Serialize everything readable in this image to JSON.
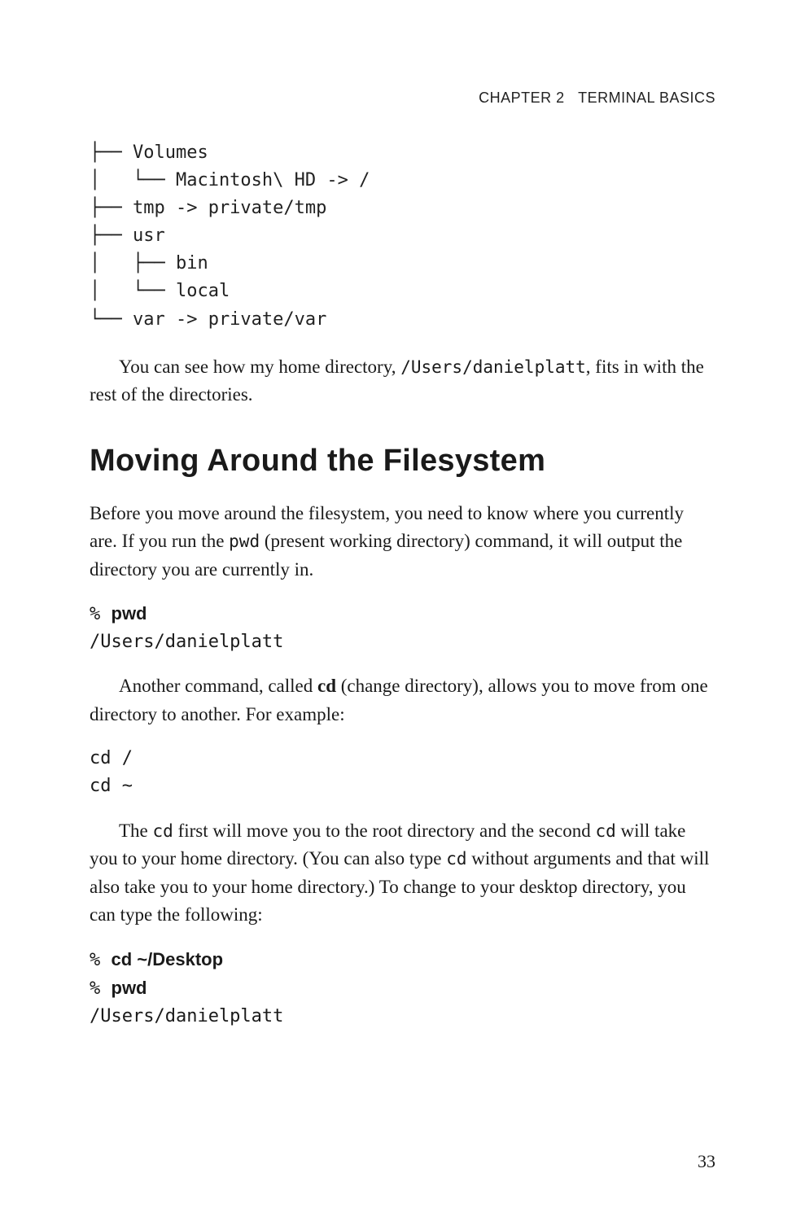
{
  "header": {
    "chapter_label": "CHAPTER 2",
    "chapter_title": "TERMINAL BASICS"
  },
  "tree_lines": [
    "├── Volumes",
    "│   └── Macintosh\\ HD -> /",
    "├── tmp -> private/tmp",
    "├── usr",
    "│   ├── bin",
    "│   └── local",
    "└── var -> private/var"
  ],
  "p1_a": "You can see how my home directory, ",
  "p1_code": "/Users/danielplatt",
  "p1_b": ", fits in with the rest of the directories.",
  "heading": "Moving Around the Filesystem",
  "p2_a": "Before you move around the filesystem, you need to know where you currently are. If you run the ",
  "p2_code": "pwd",
  "p2_b": " (present working directory) command, it will output the directory you are currently in.",
  "code1_prompt": "% ",
  "code1_cmd": "pwd",
  "code1_out": "/Users/danielplatt",
  "p3_a": "Another command, called ",
  "p3_bold": "cd",
  "p3_b": " (change directory), allows you to move from one directory to another. For example:",
  "code2_l1": "cd /",
  "code2_l2": "cd ~",
  "p4_a": "The ",
  "p4_code1": "cd",
  "p4_b": " first will move you to the root directory and the second ",
  "p4_code2": "cd",
  "p4_c": " will take you to your home directory. (You can also type ",
  "p4_code3": "cd",
  "p4_d": " without arguments and that will also take you to your home directory.) To change to your desktop directory, you can type the following:",
  "code3_p1": "% ",
  "code3_c1": "cd ~/Desktop",
  "code3_p2": "% ",
  "code3_c2": "pwd",
  "code3_out": "/Users/danielplatt",
  "page_number": "33"
}
